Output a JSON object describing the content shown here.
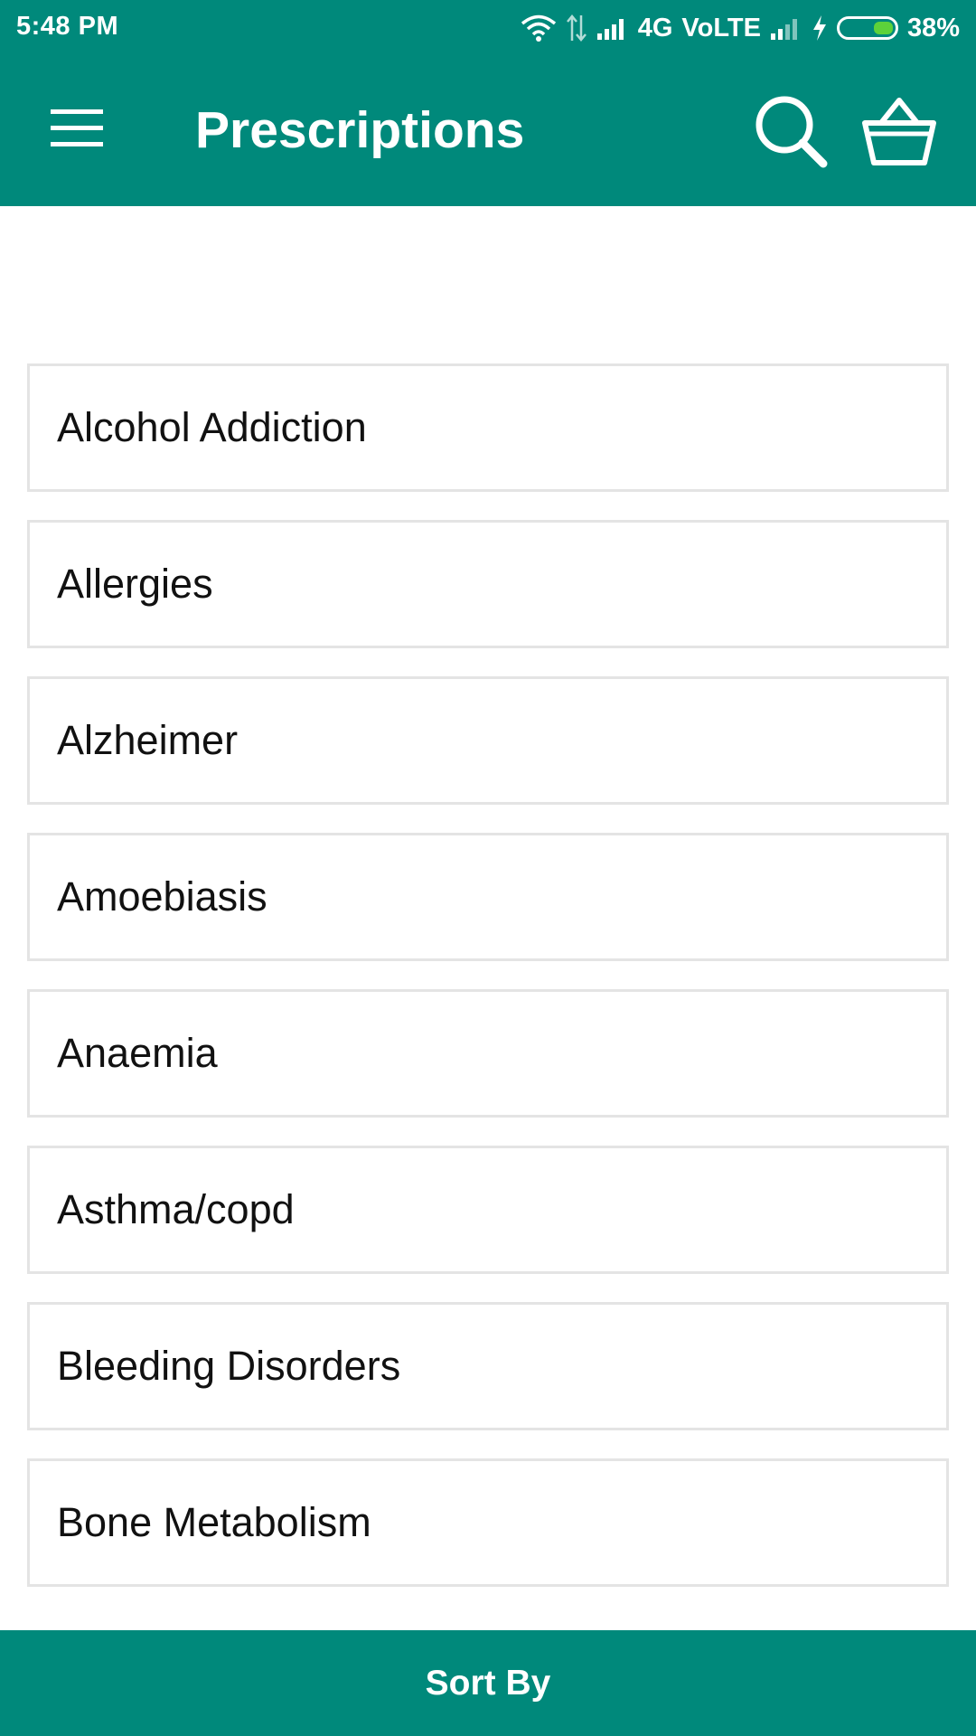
{
  "status_bar": {
    "time": "5:48 PM",
    "network": "4G",
    "volte": "VoLTE",
    "battery": "38%",
    "battery_level": 0.38
  },
  "header": {
    "title": "Prescriptions",
    "menu_icon": "hamburger-menu-icon",
    "search_icon": "search-icon",
    "cart_icon": "basket-icon"
  },
  "list": {
    "items": [
      "Alcohol Addiction",
      "Allergies",
      "Alzheimer",
      "Amoebiasis",
      "Anaemia",
      "Asthma/copd",
      "Bleeding Disorders",
      "Bone Metabolism"
    ]
  },
  "footer": {
    "sort_label": "Sort By"
  },
  "colors": {
    "primary": "#00897b",
    "item_border": "#e4e4e4",
    "battery_fill": "#5dd23a"
  }
}
